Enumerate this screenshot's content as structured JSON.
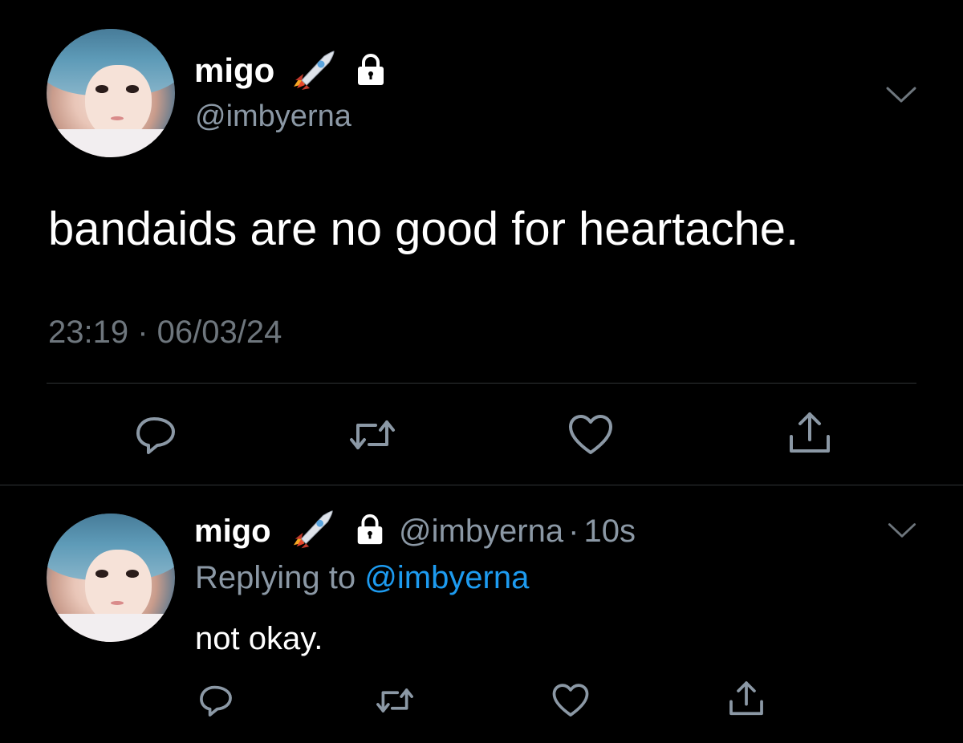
{
  "tweet": {
    "author": {
      "name": "migo",
      "handle": "@imbyerna",
      "emoji_icon": "rocket-icon",
      "lock_icon": "lock-icon"
    },
    "text": "bandaids are no good for heartache.",
    "timestamp": "23:19 · 06/03/24",
    "actions": [
      "reply-icon",
      "retweet-icon",
      "like-icon",
      "share-icon"
    ]
  },
  "reply": {
    "author": {
      "name": "migo",
      "handle": "@imbyerna",
      "separator": "·",
      "time": "10s"
    },
    "replying_prefix": "Replying to",
    "replying_handle": "@imbyerna",
    "text": "not okay.",
    "actions": [
      "reply-icon",
      "retweet-icon",
      "like-icon",
      "share-icon"
    ]
  },
  "colors": {
    "background": "#000000",
    "text": "#ffffff",
    "secondary": "#8b98a5",
    "link": "#1d9bf0",
    "divider": "#2f3336"
  }
}
